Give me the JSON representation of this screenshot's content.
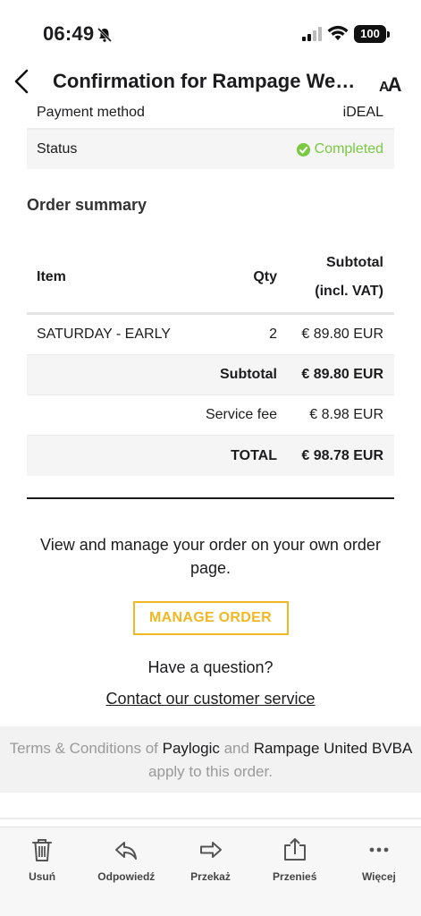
{
  "status_bar": {
    "time": "06:49",
    "battery": "100"
  },
  "nav": {
    "title": "Confirmation for Rampage Weeke...",
    "text_size_label": "AA"
  },
  "info": {
    "payment_method_label": "Payment method",
    "payment_method_value": "iDEAL",
    "status_label": "Status",
    "status_value": "Completed"
  },
  "order_summary": {
    "title": "Order summary",
    "headers": {
      "item": "Item",
      "qty": "Qty",
      "subtotal_line1": "Subtotal",
      "subtotal_line2": "(incl. VAT)"
    },
    "rows": [
      {
        "item": "SATURDAY - EARLY",
        "qty": "2",
        "subtotal": "€ 89.80 EUR"
      }
    ],
    "subtotal_label": "Subtotal",
    "subtotal_value": "€ 89.80 EUR",
    "service_fee_label": "Service fee",
    "service_fee_value": "€ 8.98 EUR",
    "total_label": "TOTAL",
    "total_value": "€ 98.78 EUR"
  },
  "manage": {
    "text": "View and manage your order on your own order page.",
    "button_label": "MANAGE ORDER",
    "question": "Have a question?",
    "contact_link": "Contact our customer service"
  },
  "terms": {
    "part1": "Terms & Conditions of ",
    "paylogic": "Paylogic",
    "part2": " and ",
    "rampage": "Rampage United BVBA",
    "part3": " apply to this order."
  },
  "toolbar": {
    "delete": "Usuń",
    "reply": "Odpowiedź",
    "forward": "Przekaż",
    "move": "Przenieś",
    "more": "Więcej"
  },
  "colors": {
    "accent": "#f2b824",
    "success": "#7ac943"
  }
}
